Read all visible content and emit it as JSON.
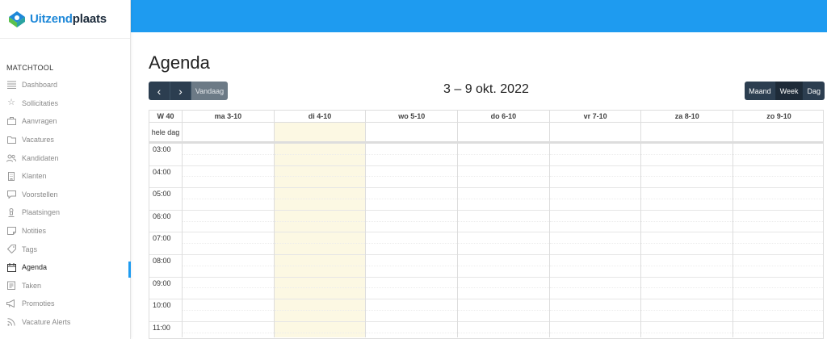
{
  "brand": {
    "name_part1": "Uitzend",
    "name_part2": "plaats",
    "accent": "#1e9bf0"
  },
  "sidebar": {
    "section": "MATCHTOOL",
    "items": [
      {
        "label": "Dashboard",
        "icon": "list-icon"
      },
      {
        "label": "Sollicitaties",
        "icon": "star-icon"
      },
      {
        "label": "Aanvragen",
        "icon": "briefcase-icon"
      },
      {
        "label": "Vacatures",
        "icon": "folder-icon"
      },
      {
        "label": "Kandidaten",
        "icon": "users-icon"
      },
      {
        "label": "Klanten",
        "icon": "building-icon"
      },
      {
        "label": "Voorstellen",
        "icon": "chat-icon"
      },
      {
        "label": "Plaatsingen",
        "icon": "person-icon"
      },
      {
        "label": "Notities",
        "icon": "note-icon"
      },
      {
        "label": "Tags",
        "icon": "tag-icon"
      },
      {
        "label": "Agenda",
        "icon": "calendar-icon",
        "active": true
      },
      {
        "label": "Taken",
        "icon": "clipboard-icon"
      },
      {
        "label": "Promoties",
        "icon": "megaphone-icon"
      },
      {
        "label": "Vacature Alerts",
        "icon": "rss-icon"
      }
    ]
  },
  "page": {
    "title": "Agenda"
  },
  "toolbar": {
    "prev": "‹",
    "next": "›",
    "today": "Vandaag",
    "range": "3 – 9 okt. 2022",
    "views": [
      "Maand",
      "Week",
      "Dag"
    ],
    "active_view": "Week"
  },
  "calendar": {
    "week_label": "W 40",
    "allday_label": "hele dag",
    "days": [
      "ma 3-10",
      "di 4-10",
      "wo 5-10",
      "do 6-10",
      "vr 7-10",
      "za 8-10",
      "zo 9-10"
    ],
    "today_index": 1,
    "today_color": "#fcf8e3",
    "times": [
      "03:00",
      "04:00",
      "05:00",
      "06:00",
      "07:00",
      "08:00",
      "09:00",
      "10:00",
      "11:00"
    ]
  }
}
